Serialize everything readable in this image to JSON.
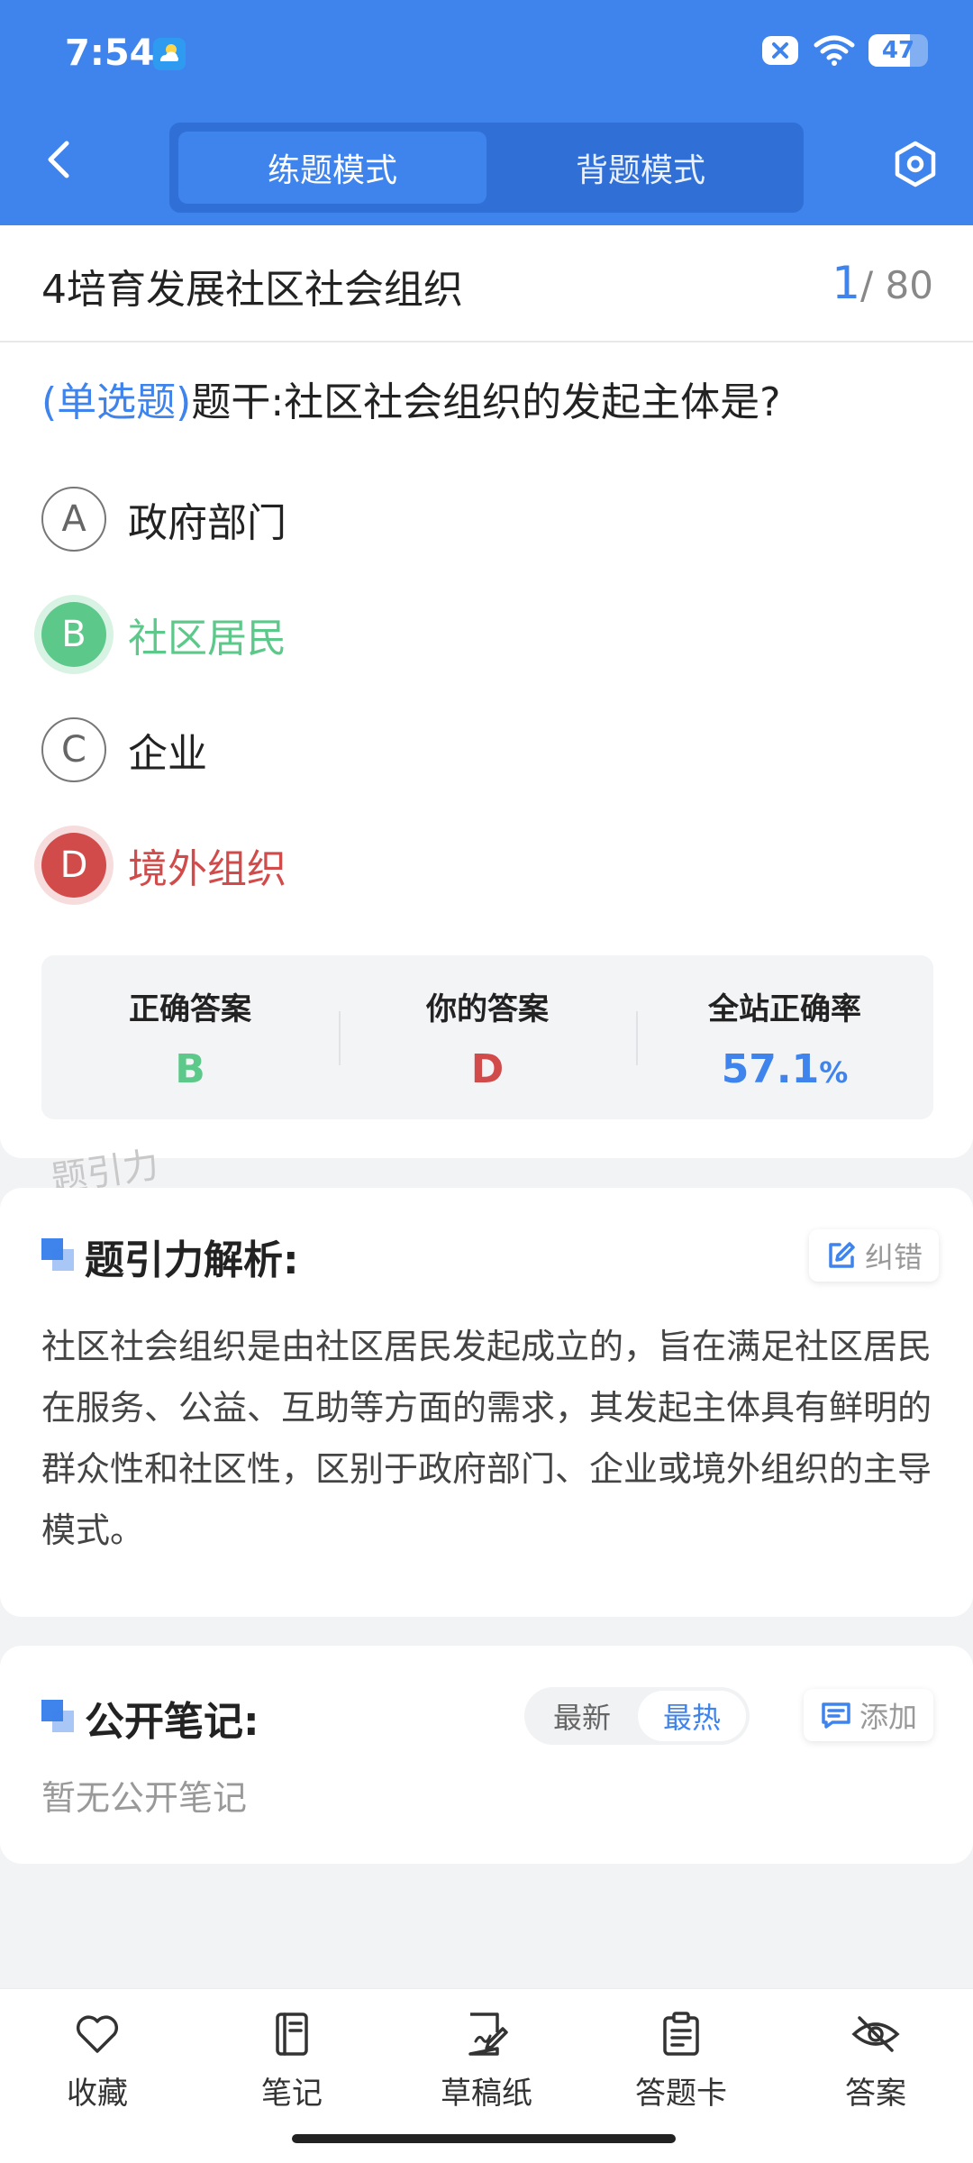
{
  "status_bar": {
    "time": "7:54",
    "battery": "47"
  },
  "header": {
    "mode_tabs": [
      {
        "label": "练题模式",
        "active": true
      },
      {
        "label": "背题模式",
        "active": false
      }
    ]
  },
  "question": {
    "chapter": "4培育发展社区社会组织",
    "progress_current": "1",
    "progress_total": "/ 80",
    "type": "(单选题)",
    "stem": "题干:社区社会组织的发起主体是?",
    "options": [
      {
        "letter": "A",
        "text": "政府部门",
        "state": "normal"
      },
      {
        "letter": "B",
        "text": "社区居民",
        "state": "correct"
      },
      {
        "letter": "C",
        "text": "企业",
        "state": "normal"
      },
      {
        "letter": "D",
        "text": "境外组织",
        "state": "wrong"
      }
    ]
  },
  "stats": {
    "correct_label": "正确答案",
    "correct_value": "B",
    "yours_label": "你的答案",
    "yours_value": "D",
    "rate_label": "全站正确率",
    "rate_value": "57.1",
    "rate_unit": "%"
  },
  "watermark": "题引力",
  "analysis": {
    "title": "题引力解析:",
    "report_label": "纠错",
    "text": "社区社会组织是由社区居民发起成立的，旨在满足社区居民在服务、公益、互助等方面的需求，其发起主体具有鲜明的群众性和社区性，区别于政府部门、企业或境外组织的主导模式。"
  },
  "notes": {
    "title": "公开笔记:",
    "sort_latest": "最新",
    "sort_hot": "最热",
    "add_label": "添加",
    "empty_text": "暂无公开笔记"
  },
  "bottom_nav": [
    {
      "label": "收藏",
      "icon": "heart-icon"
    },
    {
      "label": "笔记",
      "icon": "notebook-icon"
    },
    {
      "label": "草稿纸",
      "icon": "draft-icon"
    },
    {
      "label": "答题卡",
      "icon": "answer-card-icon"
    },
    {
      "label": "答案",
      "icon": "eye-off-icon"
    }
  ],
  "colors": {
    "brand_blue": "#3f83ec",
    "correct_green": "#5cc88a",
    "wrong_red": "#d24b4b"
  }
}
